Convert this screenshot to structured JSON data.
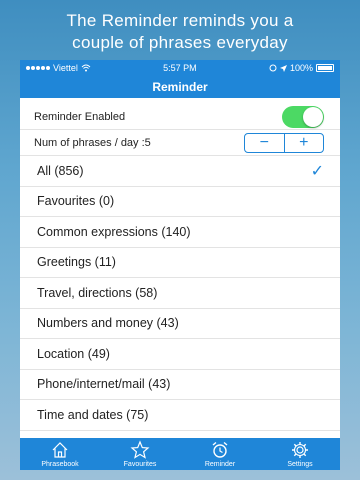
{
  "promo": {
    "line1": "The Reminder reminds you a",
    "line2": "couple of phrases everyday"
  },
  "statusbar": {
    "carrier": "Viettel",
    "time": "5:57 PM",
    "battery": "100%"
  },
  "navbar": {
    "title": "Reminder"
  },
  "settings": {
    "reminder_enabled_label": "Reminder Enabled",
    "reminder_enabled": true,
    "phrases_per_day_label": "Num of phrases / day :5",
    "minus": "−",
    "plus": "+"
  },
  "categories": [
    {
      "label": "All (856)",
      "checked": true
    },
    {
      "label": "Favourites (0)"
    },
    {
      "label": "Common expressions (140)"
    },
    {
      "label": "Greetings (11)"
    },
    {
      "label": "Travel, directions (58)"
    },
    {
      "label": "Numbers and money (43)"
    },
    {
      "label": "Location (49)"
    },
    {
      "label": "Phone/internet/mail (43)"
    },
    {
      "label": "Time and dates (75)"
    }
  ],
  "tabs": [
    {
      "label": "Phrasebook",
      "icon": "home-icon"
    },
    {
      "label": "Favourites",
      "icon": "star-icon"
    },
    {
      "label": "Reminder",
      "icon": "alarm-clock-icon",
      "active": true
    },
    {
      "label": "Settings",
      "icon": "gear-icon"
    }
  ],
  "colors": {
    "accent": "#1f86d8",
    "toggle_on": "#4cd964"
  },
  "check_glyph": "✓"
}
